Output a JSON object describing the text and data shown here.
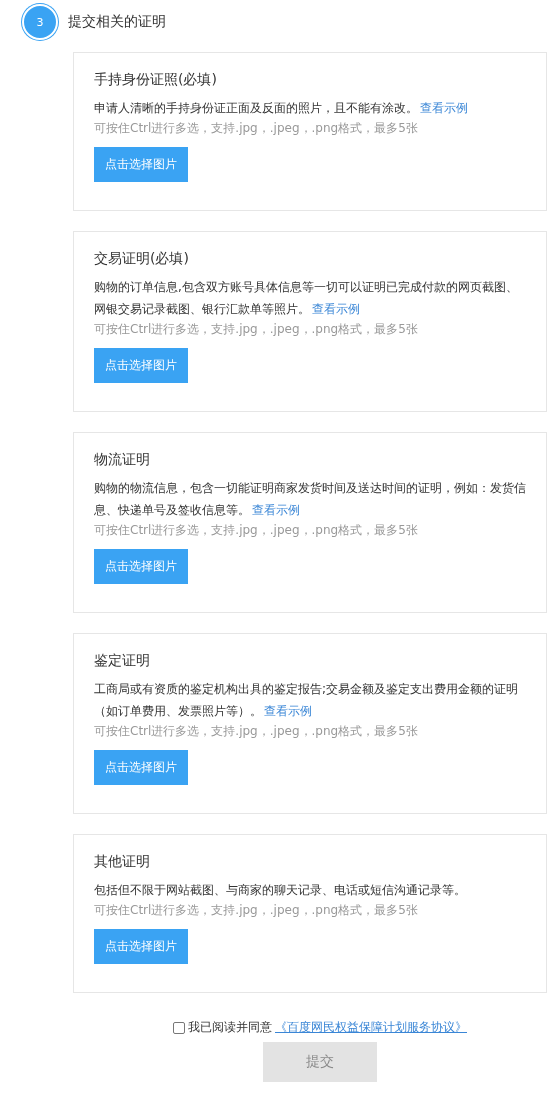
{
  "step": {
    "number": "3",
    "title": "提交相关的证明"
  },
  "sections": [
    {
      "title": "手持身份证照(必填)",
      "description": "申请人清晰的手持身份证正面及反面的照片，且不能有涂改。",
      "example_link": "查看示例",
      "hint": "可按住Ctrl进行多选，支持.jpg，.jpeg，.png格式，最多5张",
      "button": "点击选择图片"
    },
    {
      "title": "交易证明(必填)",
      "description": "购物的订单信息,包含双方账号具体信息等一切可以证明已完成付款的网页截图、网银交易记录截图、银行汇款单等照片。",
      "example_link": "查看示例",
      "hint": "可按住Ctrl进行多选，支持.jpg，.jpeg，.png格式，最多5张",
      "button": "点击选择图片"
    },
    {
      "title": "物流证明",
      "description": "购物的物流信息，包含一切能证明商家发货时间及送达时间的证明，例如：发货信息、快递单号及签收信息等。",
      "example_link": "查看示例",
      "hint": "可按住Ctrl进行多选，支持.jpg，.jpeg，.png格式，最多5张",
      "button": "点击选择图片"
    },
    {
      "title": "鉴定证明",
      "description": "工商局或有资质的鉴定机构出具的鉴定报告;交易金额及鉴定支出费用金额的证明（如订单费用、发票照片等）。",
      "example_link": "查看示例",
      "hint": "可按住Ctrl进行多选，支持.jpg，.jpeg，.png格式，最多5张",
      "button": "点击选择图片"
    },
    {
      "title": "其他证明",
      "description": "包括但不限于网站截图、与商家的聊天记录、电话或短信沟通记录等。",
      "hint": "可按住Ctrl进行多选，支持.jpg，.jpeg，.png格式，最多5张",
      "button": "点击选择图片"
    }
  ],
  "agreement": {
    "checked": false,
    "label": "我已阅读并同意",
    "link": "《百度网民权益保障计划服务协议》"
  },
  "submit": {
    "label": "提交",
    "disabled": true
  }
}
